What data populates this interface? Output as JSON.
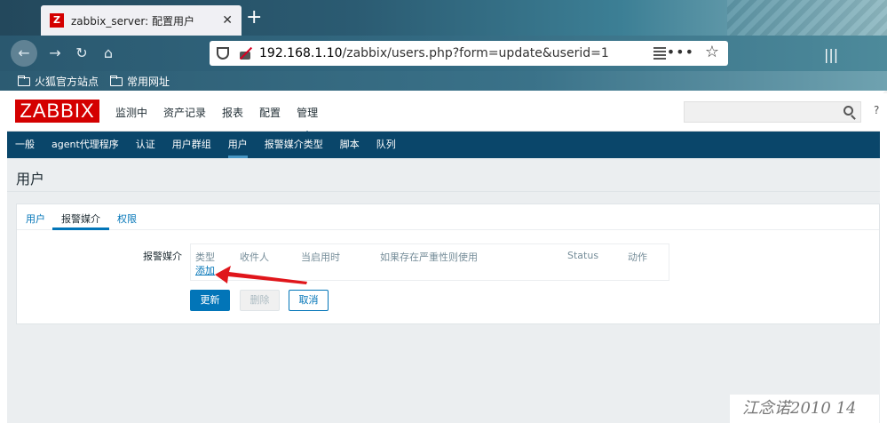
{
  "browser": {
    "tab_favicon": "Z",
    "tab_title": "zabbix_server: 配置用户",
    "tab_close": "✕",
    "new_tab": "+",
    "url_host": "192.168.1.10",
    "url_path": "/zabbix/users.php?form=update&userid=1",
    "more_label": "•••",
    "bookmarks": [
      "火狐官方站点",
      "常用网址"
    ]
  },
  "zabbix": {
    "logo": "ZABBIX",
    "main_menu": [
      {
        "label": "监测中",
        "active": false
      },
      {
        "label": "资产记录",
        "active": false
      },
      {
        "label": "报表",
        "active": false
      },
      {
        "label": "配置",
        "active": false
      },
      {
        "label": "管理",
        "active": true
      }
    ],
    "sub_menu": [
      {
        "label": "一般",
        "active": false
      },
      {
        "label": "agent代理程序",
        "active": false
      },
      {
        "label": "认证",
        "active": false
      },
      {
        "label": "用户群组",
        "active": false
      },
      {
        "label": "用户",
        "active": true
      },
      {
        "label": "报警媒介类型",
        "active": false
      },
      {
        "label": "脚本",
        "active": false
      },
      {
        "label": "队列",
        "active": false
      }
    ],
    "page_title": "用户",
    "tabs": [
      {
        "label": "用户",
        "active": false
      },
      {
        "label": "报警媒介",
        "active": true
      },
      {
        "label": "权限",
        "active": false
      }
    ],
    "media_label": "报警媒介",
    "media_table": {
      "columns": [
        "类型",
        "收件人",
        "当启用时",
        "如果存在严重性则使用",
        "Status",
        "动作"
      ],
      "add_link": "添加"
    },
    "buttons": {
      "update": "更新",
      "delete": "删除",
      "cancel": "取消"
    }
  },
  "watermark": "江念诺2010 14",
  "colors": {
    "accent": "#0275b8",
    "nav": "#0a466a",
    "logo": "#d40000",
    "arrow": "#e0161b"
  }
}
